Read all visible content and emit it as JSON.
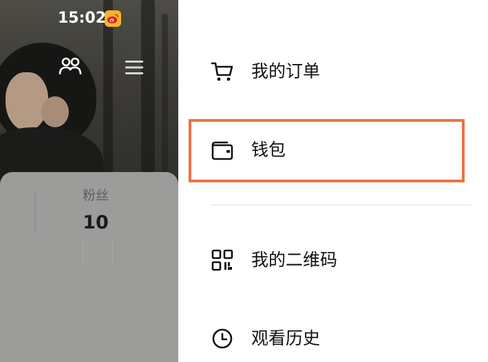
{
  "status_bar": {
    "time": "15:02",
    "app_badge_icon": "weibo-icon"
  },
  "profile": {
    "top_icons": [
      "people-icon",
      "hamburger-menu-icon"
    ],
    "stats": {
      "label": "粉丝",
      "value": "10"
    }
  },
  "drawer_menu": {
    "items": [
      {
        "label": "我的订单",
        "icon": "shopping-cart-icon"
      },
      {
        "label": "钱包",
        "icon": "wallet-icon",
        "highlighted": true
      },
      {
        "label": "我的二维码",
        "icon": "qr-code-icon"
      },
      {
        "label": "观看历史",
        "icon": "clock-icon"
      }
    ]
  },
  "colors": {
    "highlight_border": "#ec7146",
    "weibo_badge": "#f3b626",
    "text_primary": "#111111",
    "overlay_card": "#9c9c9b"
  }
}
